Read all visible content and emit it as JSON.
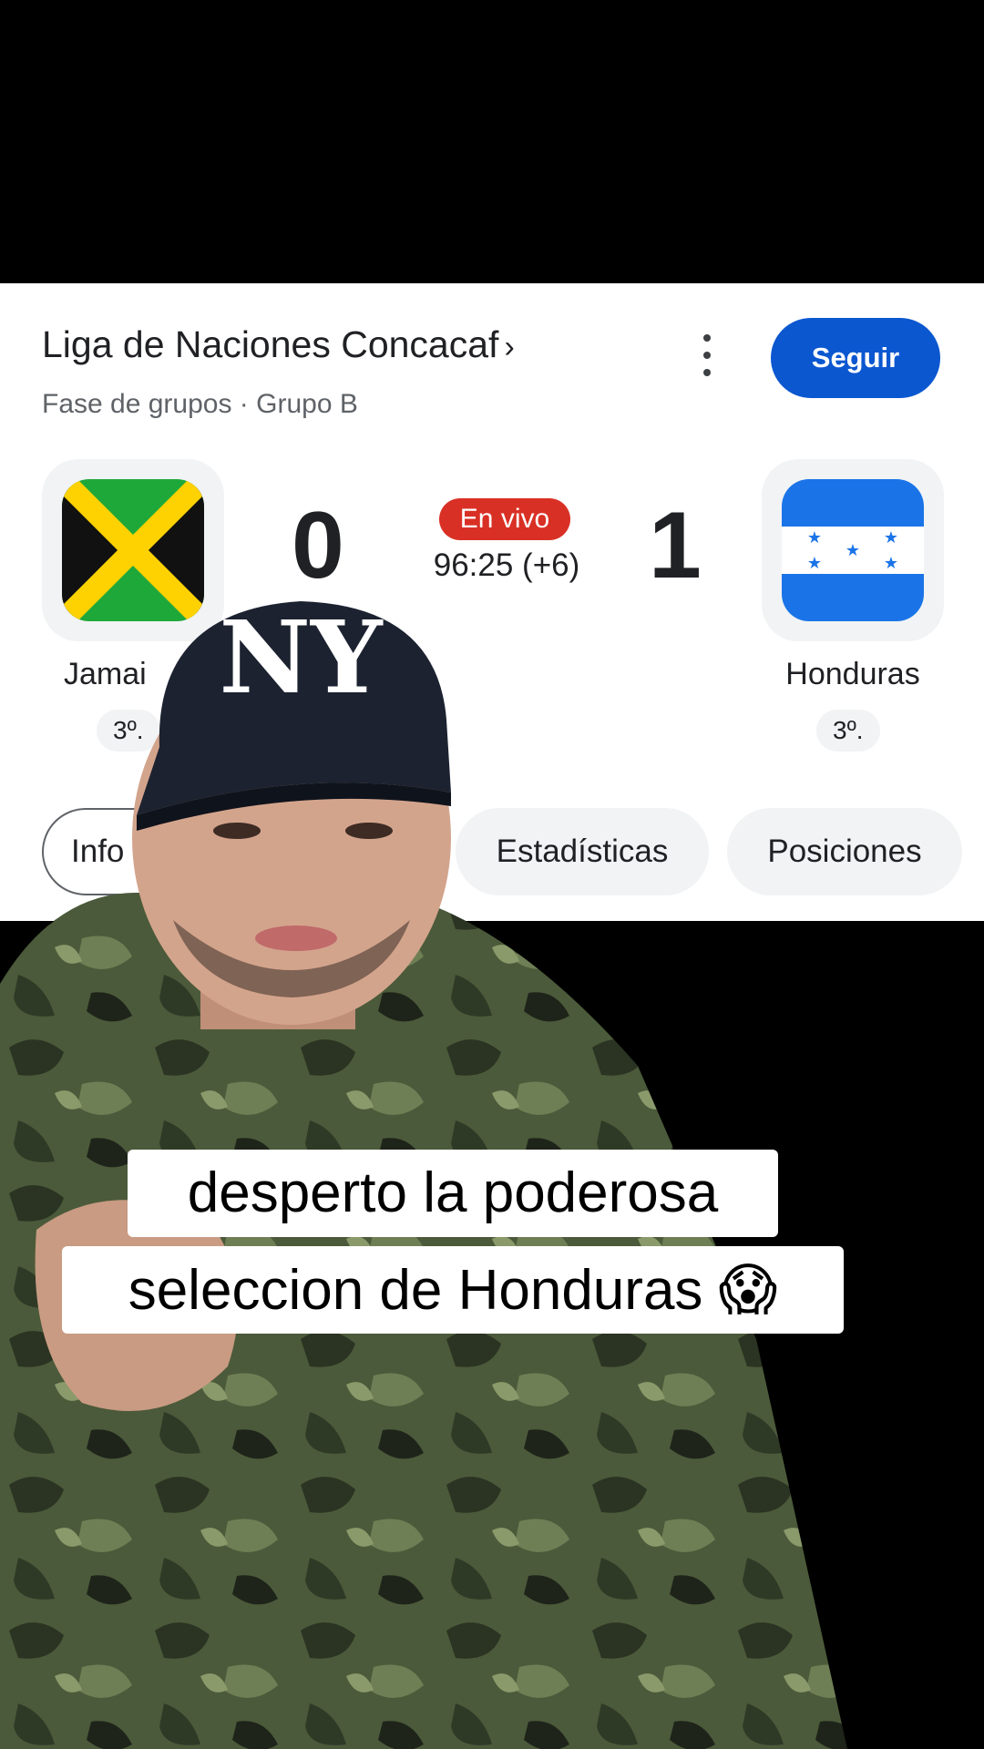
{
  "league": {
    "title": "Liga de Naciones Concacaf",
    "chevron": "›",
    "subtitle": "Fase de grupos · Grupo B",
    "menu_icon": "more-vert-icon",
    "follow_label": "Seguir"
  },
  "match": {
    "home": {
      "name": "Jamaica",
      "name_visible": "Jamai",
      "score": "0",
      "rank": "3º."
    },
    "away": {
      "name": "Honduras",
      "score": "1",
      "rank": "3º."
    },
    "status": "En vivo",
    "clock": "96:25 (+6)"
  },
  "tabs": [
    {
      "label": "Info",
      "label_visible": "Info"
    },
    {
      "label": "Estadísticas"
    },
    {
      "label": "Posiciones"
    }
  ],
  "caption": {
    "line1": "desperto la poderosa",
    "line2": "seleccion de Honduras",
    "emoji": "😱"
  },
  "colors": {
    "accent": "#0b57d0",
    "live": "#d93025",
    "jamaica_green": "#1fa83a",
    "jamaica_yellow": "#fed100",
    "honduras_blue": "#1a74e8"
  }
}
